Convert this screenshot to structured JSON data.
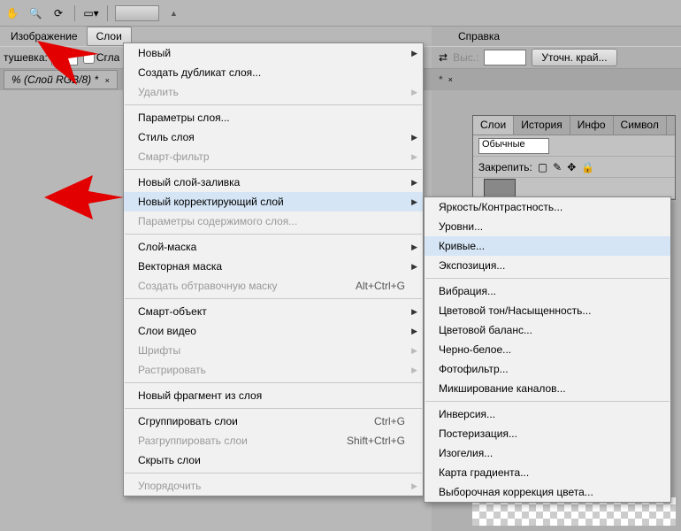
{
  "toolbar": {
    "icons": [
      "hand-icon",
      "zoom-icon",
      "rotate-icon"
    ]
  },
  "menubar": {
    "image": "Изображение",
    "layers": "Слои",
    "help": "Справка"
  },
  "options": {
    "feather_label": "тушевка:",
    "smooth_label": "Сгла",
    "height_label": "Выс.:",
    "refine_btn": "Уточн. край..."
  },
  "doc_tab": "% (Слой    RGB/8) *",
  "panels": {
    "tabs": [
      "Слои",
      "История",
      "Инфо",
      "Символ"
    ],
    "blend_mode": "Обычные",
    "lock_label": "Закрепить:"
  },
  "main_menu": [
    {
      "label": "Новый",
      "arrow": true
    },
    {
      "label": "Создать дубликат слоя..."
    },
    {
      "label": "Удалить",
      "arrow": true,
      "disabled": true
    },
    {
      "sep": true
    },
    {
      "label": "Параметры слоя..."
    },
    {
      "label": "Стиль слоя",
      "arrow": true
    },
    {
      "label": "Смарт-фильтр",
      "arrow": true,
      "disabled": true
    },
    {
      "sep": true
    },
    {
      "label": "Новый слой-заливка",
      "arrow": true
    },
    {
      "label": "Новый корректирующий слой",
      "arrow": true,
      "highlight": true
    },
    {
      "label": "Параметры содержимого слоя...",
      "disabled": true
    },
    {
      "sep": true
    },
    {
      "label": "Слой-маска",
      "arrow": true
    },
    {
      "label": "Векторная маска",
      "arrow": true
    },
    {
      "label": "Создать обтравочную маску",
      "shortcut": "Alt+Ctrl+G",
      "disabled": true
    },
    {
      "sep": true
    },
    {
      "label": "Смарт-объект",
      "arrow": true
    },
    {
      "label": "Слои видео",
      "arrow": true
    },
    {
      "label": "Шрифты",
      "arrow": true,
      "disabled": true
    },
    {
      "label": "Растрировать",
      "arrow": true,
      "disabled": true
    },
    {
      "sep": true
    },
    {
      "label": "Новый фрагмент из слоя"
    },
    {
      "sep": true
    },
    {
      "label": "Сгруппировать слои",
      "shortcut": "Ctrl+G"
    },
    {
      "label": "Разгруппировать слои",
      "shortcut": "Shift+Ctrl+G",
      "disabled": true
    },
    {
      "label": "Скрыть слои"
    },
    {
      "sep": true
    },
    {
      "label": "Упорядочить",
      "arrow": true,
      "disabled": true
    }
  ],
  "sub_menu": [
    {
      "label": "Яркость/Контрастность..."
    },
    {
      "label": "Уровни..."
    },
    {
      "label": "Кривые...",
      "highlight": true
    },
    {
      "label": "Экспозиция..."
    },
    {
      "sep": true
    },
    {
      "label": "Вибрация..."
    },
    {
      "label": "Цветовой тон/Насыщенность..."
    },
    {
      "label": "Цветовой баланс..."
    },
    {
      "label": "Черно-белое..."
    },
    {
      "label": "Фотофильтр..."
    },
    {
      "label": "Микширование каналов..."
    },
    {
      "sep": true
    },
    {
      "label": "Инверсия..."
    },
    {
      "label": "Постеризация..."
    },
    {
      "label": "Изогелия..."
    },
    {
      "label": "Карта градиента..."
    },
    {
      "label": "Выборочная коррекция цвета..."
    }
  ]
}
